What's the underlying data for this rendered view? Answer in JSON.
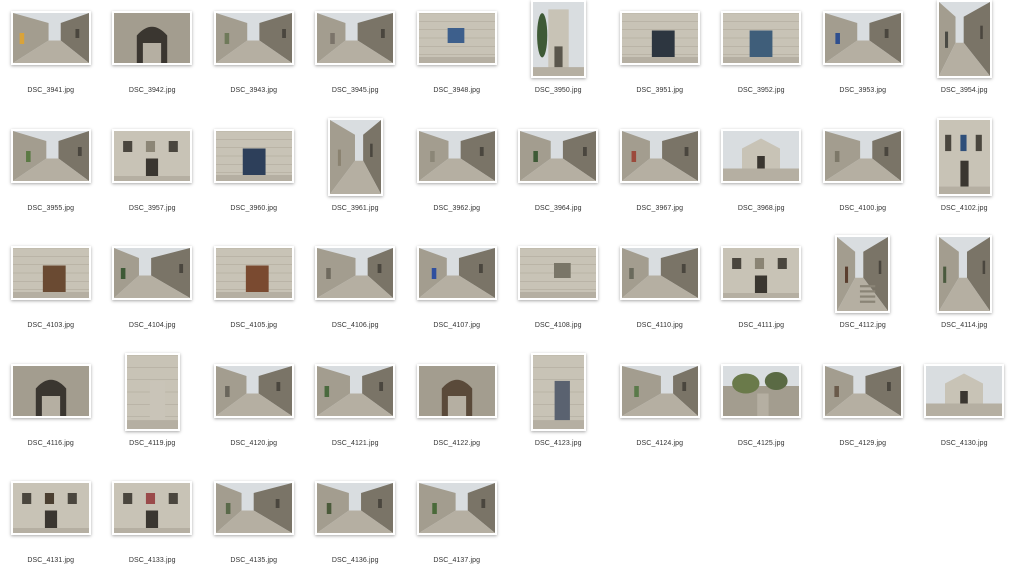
{
  "files": [
    {
      "name": "DSC_3941.jpg",
      "orientation": "landscape",
      "scene": "street",
      "accent": "#d9a33a"
    },
    {
      "name": "DSC_3942.jpg",
      "orientation": "landscape",
      "scene": "arch",
      "accent": "#8a8478"
    },
    {
      "name": "DSC_3943.jpg",
      "orientation": "landscape",
      "scene": "street",
      "accent": "#6f7a5a"
    },
    {
      "name": "DSC_3945.jpg",
      "orientation": "landscape",
      "scene": "street",
      "accent": "#7b746a"
    },
    {
      "name": "DSC_3948.jpg",
      "orientation": "landscape",
      "scene": "window",
      "accent": "#3d5f8c"
    },
    {
      "name": "DSC_3950.jpg",
      "orientation": "portrait",
      "scene": "tower",
      "accent": "#3e5a36"
    },
    {
      "name": "DSC_3951.jpg",
      "orientation": "landscape",
      "scene": "sign",
      "accent": "#2d3640"
    },
    {
      "name": "DSC_3952.jpg",
      "orientation": "landscape",
      "scene": "door",
      "accent": "#3f5e7a"
    },
    {
      "name": "DSC_3953.jpg",
      "orientation": "landscape",
      "scene": "street",
      "accent": "#2f4f8f"
    },
    {
      "name": "DSC_3954.jpg",
      "orientation": "portrait",
      "scene": "street",
      "accent": "#4a4a44"
    },
    {
      "name": "DSC_3955.jpg",
      "orientation": "landscape",
      "scene": "street",
      "accent": "#5b7a44"
    },
    {
      "name": "DSC_3957.jpg",
      "orientation": "landscape",
      "scene": "facade",
      "accent": "#8c8676"
    },
    {
      "name": "DSC_3960.jpg",
      "orientation": "landscape",
      "scene": "shop",
      "accent": "#2d3f5a"
    },
    {
      "name": "DSC_3961.jpg",
      "orientation": "portrait",
      "scene": "street",
      "accent": "#8a8270"
    },
    {
      "name": "DSC_3962.jpg",
      "orientation": "landscape",
      "scene": "street",
      "accent": "#8b8677"
    },
    {
      "name": "DSC_3964.jpg",
      "orientation": "landscape",
      "scene": "street",
      "accent": "#3e5a36"
    },
    {
      "name": "DSC_3967.jpg",
      "orientation": "landscape",
      "scene": "street",
      "accent": "#9c4a3c"
    },
    {
      "name": "DSC_3968.jpg",
      "orientation": "landscape",
      "scene": "chapel",
      "accent": "#8c8371"
    },
    {
      "name": "DSC_4100.jpg",
      "orientation": "landscape",
      "scene": "street",
      "accent": "#7d7869"
    },
    {
      "name": "DSC_4102.jpg",
      "orientation": "portrait",
      "scene": "facade",
      "accent": "#2f4f7a"
    },
    {
      "name": "DSC_4103.jpg",
      "orientation": "landscape",
      "scene": "door",
      "accent": "#6a4a32"
    },
    {
      "name": "DSC_4104.jpg",
      "orientation": "landscape",
      "scene": "street",
      "accent": "#3e5a36"
    },
    {
      "name": "DSC_4105.jpg",
      "orientation": "landscape",
      "scene": "shop",
      "accent": "#7a4a30"
    },
    {
      "name": "DSC_4106.jpg",
      "orientation": "landscape",
      "scene": "street",
      "accent": "#6f6a5e"
    },
    {
      "name": "DSC_4107.jpg",
      "orientation": "landscape",
      "scene": "street",
      "accent": "#2f4f9f"
    },
    {
      "name": "DSC_4108.jpg",
      "orientation": "landscape",
      "scene": "window",
      "accent": "#7a7668"
    },
    {
      "name": "DSC_4110.jpg",
      "orientation": "landscape",
      "scene": "street",
      "accent": "#6a6a5c"
    },
    {
      "name": "DSC_4111.jpg",
      "orientation": "landscape",
      "scene": "facade",
      "accent": "#8a8474"
    },
    {
      "name": "DSC_4112.jpg",
      "orientation": "portrait",
      "scene": "stairs",
      "accent": "#5a3e2e"
    },
    {
      "name": "DSC_4114.jpg",
      "orientation": "portrait",
      "scene": "street",
      "accent": "#4a5a3e"
    },
    {
      "name": "DSC_4116.jpg",
      "orientation": "landscape",
      "scene": "arch",
      "accent": "#2a2826"
    },
    {
      "name": "DSC_4119.jpg",
      "orientation": "portrait",
      "scene": "door",
      "accent": "#c9c4b8"
    },
    {
      "name": "DSC_4120.jpg",
      "orientation": "landscape",
      "scene": "street",
      "accent": "#6a665c"
    },
    {
      "name": "DSC_4121.jpg",
      "orientation": "landscape",
      "scene": "street",
      "accent": "#4a6a3e"
    },
    {
      "name": "DSC_4122.jpg",
      "orientation": "landscape",
      "scene": "gate",
      "accent": "#5a4a3a"
    },
    {
      "name": "DSC_4123.jpg",
      "orientation": "portrait",
      "scene": "door",
      "accent": "#5a6270"
    },
    {
      "name": "DSC_4124.jpg",
      "orientation": "landscape",
      "scene": "street",
      "accent": "#5a7a4a"
    },
    {
      "name": "DSC_4125.jpg",
      "orientation": "landscape",
      "scene": "ruins",
      "accent": "#6a7a4a"
    },
    {
      "name": "DSC_4129.jpg",
      "orientation": "landscape",
      "scene": "street",
      "accent": "#6a5a4a"
    },
    {
      "name": "DSC_4130.jpg",
      "orientation": "landscape",
      "scene": "chapel",
      "accent": "#8a8678"
    },
    {
      "name": "DSC_4131.jpg",
      "orientation": "landscape",
      "scene": "facade",
      "accent": "#4a3e30"
    },
    {
      "name": "DSC_4133.jpg",
      "orientation": "landscape",
      "scene": "facade",
      "accent": "#9a4a4a"
    },
    {
      "name": "DSC_4135.jpg",
      "orientation": "landscape",
      "scene": "street",
      "accent": "#5a6a4a"
    },
    {
      "name": "DSC_4136.jpg",
      "orientation": "landscape",
      "scene": "street",
      "accent": "#4a5a3a"
    },
    {
      "name": "DSC_4137.jpg",
      "orientation": "landscape",
      "scene": "street",
      "accent": "#4a6a3a"
    }
  ],
  "colors": {
    "background": "#ffffff",
    "caption": "#333333",
    "stone_light": "#c8c3b6",
    "stone_mid": "#a39d8f",
    "stone_dark": "#7a7467",
    "sky": "#d9dde0",
    "paving": "#b5afa2"
  }
}
